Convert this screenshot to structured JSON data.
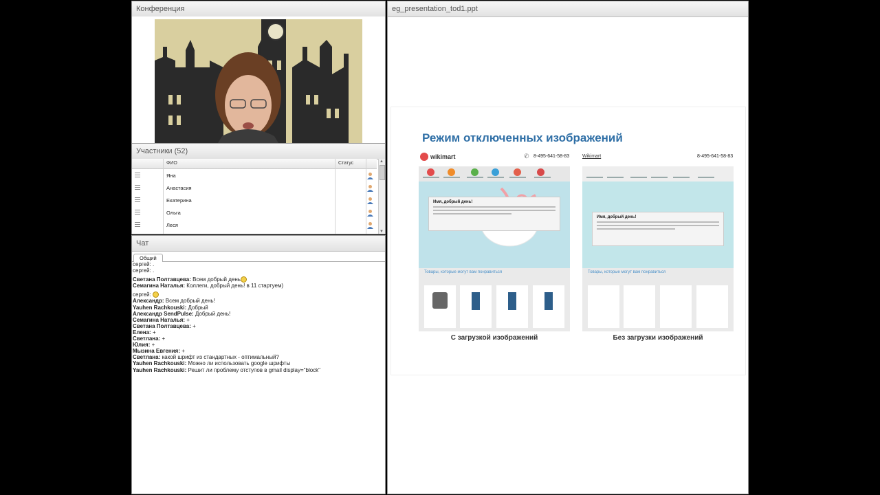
{
  "conference": {
    "title": "Конференция"
  },
  "participants": {
    "title": "Участники (52)",
    "columns": [
      "ФИО",
      "Статус"
    ],
    "rows": [
      {
        "name": "Яна"
      },
      {
        "name": "Анастасия"
      },
      {
        "name": "Екатерина"
      },
      {
        "name": "Ольга"
      },
      {
        "name": "Леся"
      }
    ]
  },
  "chat": {
    "title": "Чат",
    "tab": "Общий",
    "messages": [
      {
        "name": "сергей:",
        "text": " .",
        "bold": false
      },
      {
        "name": "сергей:",
        "text": " .",
        "bold": false
      },
      {
        "name": "Светана Полтавцева:",
        "text": " Всем добрый день",
        "smile": true,
        "gap": true
      },
      {
        "name": "Семагина Наталья:",
        "text": " Коллеги, добрый день! в 11 стартуем)"
      },
      {
        "name": "сергей:",
        "text": " ",
        "bold": false,
        "smile": true,
        "gap": true
      },
      {
        "name": "Александр:",
        "text": " Всем добрый день!"
      },
      {
        "name": "Yauhen Rachkouski:",
        "text": " Добрый"
      },
      {
        "name": "Александр SendPulse:",
        "text": " Добрый день!"
      },
      {
        "name": "Семагина Наталья:",
        "text": " +"
      },
      {
        "name": "Светана Полтавцева:",
        "text": " +"
      },
      {
        "name": "Елена:",
        "text": " +"
      },
      {
        "name": "Светлана:",
        "text": " +"
      },
      {
        "name": "Юлия:",
        "text": " +"
      },
      {
        "name": "Мызина Евгения:",
        "text": " +"
      },
      {
        "name": "Светлана:",
        "text": " какой шрифт из стандартных -  оптимальный?"
      },
      {
        "name": "Yauhen Rachkouski:",
        "text": " Можно ли использовать google шрифты"
      },
      {
        "name": "Yauhen Rachkouski:",
        "text": " Решит ли проблему отступов в gmail display=\"block\""
      }
    ]
  },
  "presentation": {
    "title": "eg_presentation_tod1.ppt",
    "slide": {
      "heading": "Режим отключенных изображений",
      "left": {
        "brand": "wikimart",
        "phone": "8-495-641-58-83",
        "box_title": "Имя, добрый день!",
        "goods_header": "Товары, которые могут вам понравиться",
        "caption": "С загрузкой изображений"
      },
      "right": {
        "brand": "Wikimart",
        "phone": "8-495-641-58-83",
        "box_title": "Имя, добрый день!",
        "goods_header": "Товары, которые могут вам понравиться",
        "caption": "Без загрузки изображений"
      }
    }
  }
}
